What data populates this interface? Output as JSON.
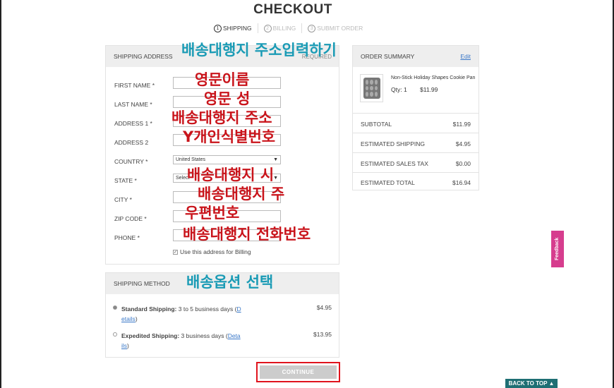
{
  "header": {
    "title": "CHECKOUT"
  },
  "steps": [
    {
      "num": "1",
      "label": "SHIPPING"
    },
    {
      "num": "2",
      "label": "BILLING"
    },
    {
      "num": "3",
      "label": "SUBMIT ORDER"
    }
  ],
  "shipping": {
    "heading": "SHIPPING ADDRESS",
    "required": "REQUIRED",
    "fields": {
      "first_name": "FIRST NAME",
      "last_name": "LAST NAME",
      "address1": "ADDRESS 1",
      "address2": "ADDRESS 2",
      "country": "COUNTRY",
      "state": "STATE",
      "city": "CITY",
      "zip": "ZIP CODE",
      "phone": "PHONE"
    },
    "country_value": "United States",
    "state_value": "Select",
    "billing_label": "Use this address for Billing"
  },
  "method": {
    "heading": "SHIPPING METHOD",
    "standard": {
      "name": "Standard Shipping:",
      "desc": "3 to 5 business days (",
      "link1": "D",
      "link2": "etails",
      "close": ")",
      "price": "$4.95"
    },
    "expedited": {
      "name": "Expedited Shipping:",
      "desc": "3 business days (",
      "link1": "Deta",
      "link2": "ils",
      "close": ")",
      "price": "$13.95"
    }
  },
  "summary": {
    "heading": "ORDER SUMMARY",
    "edit": "Edit",
    "product_name": "Non-Stick Holiday Shapes Cookie Pan",
    "qty": "Qty:  1",
    "price": "$11.99",
    "rows": [
      {
        "label": "SUBTOTAL",
        "value": "$11.99"
      },
      {
        "label": "ESTIMATED SHIPPING",
        "value": "$4.95"
      },
      {
        "label": "ESTIMATED SALES TAX",
        "value": "$0.00"
      },
      {
        "label": "ESTIMATED TOTAL",
        "value": "$16.94"
      }
    ]
  },
  "buttons": {
    "continue": "CONTINUE",
    "back_to_top": "BACK TO TOP ▲"
  },
  "feedback": "Feedback",
  "annotations": {
    "address_heading": "배송대행지 주소입력하기",
    "first_name": "영문이름",
    "last_name": "영문 성",
    "address1": "배송대행지 주소",
    "address2": "Y개인식별번호",
    "state": "배송대행지 시",
    "city": "배송대행지 주",
    "zip": "우편번호",
    "phone": "배송대행지 전화번호",
    "method": "배송옵션 선택"
  },
  "colors": {
    "annotation_red": "#c9141b",
    "annotation_teal": "#1a9bb5",
    "link": "#3a78c8",
    "highlight_border": "#e0141d"
  }
}
